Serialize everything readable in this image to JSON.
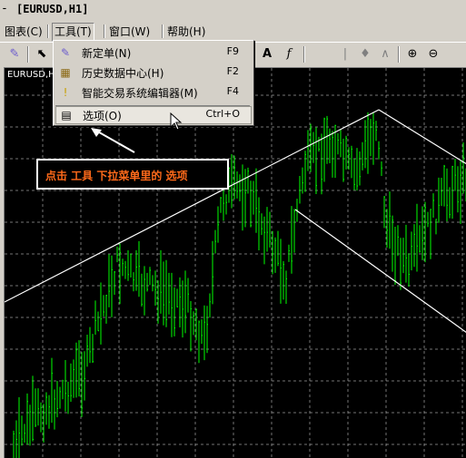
{
  "window": {
    "sys_menu": "-",
    "title": "[EURUSD,H1]"
  },
  "menubar": {
    "items": [
      {
        "label": "图表(C)"
      },
      {
        "label": "工具(T)"
      },
      {
        "label": "窗口(W)"
      },
      {
        "label": "帮助(H)"
      }
    ]
  },
  "toolbar": {
    "buttons": [
      {
        "icon": "magic-pen-icon",
        "glyph": "✎"
      },
      {
        "icon": "cursor-icon",
        "glyph": "⬉"
      },
      {
        "icon": "text-icon",
        "glyph": "A"
      },
      {
        "icon": "function-icon",
        "glyph": "f"
      },
      {
        "icon": "line-bar-icon",
        "glyph": "|"
      },
      {
        "icon": "candle-icon",
        "glyph": "♦"
      },
      {
        "icon": "line-chart-icon",
        "glyph": "∧"
      },
      {
        "icon": "zoom-in-icon",
        "glyph": "⊕"
      },
      {
        "icon": "zoom-out-icon",
        "glyph": "⊖"
      }
    ]
  },
  "chart": {
    "label": "EURUSD,H",
    "background": "#000000",
    "candle_color": "#00ff00",
    "grid_color": "#c0c0c0"
  },
  "dropdown": {
    "items": [
      {
        "label": "新定单(N)",
        "shortcut": "F9",
        "icon": "new-order-icon"
      },
      {
        "label": "历史数据中心(H)",
        "shortcut": "F2",
        "icon": "history-center-icon"
      },
      {
        "label": "智能交易系统编辑器(M)",
        "shortcut": "F4",
        "icon": "expert-editor-icon"
      },
      {
        "label": "选项(O)",
        "shortcut": "Ctrl+O",
        "icon": "options-icon"
      }
    ]
  },
  "annotation": {
    "text": "点击  工具  下拉菜单里的  选项",
    "color": "#ff6a1a"
  }
}
